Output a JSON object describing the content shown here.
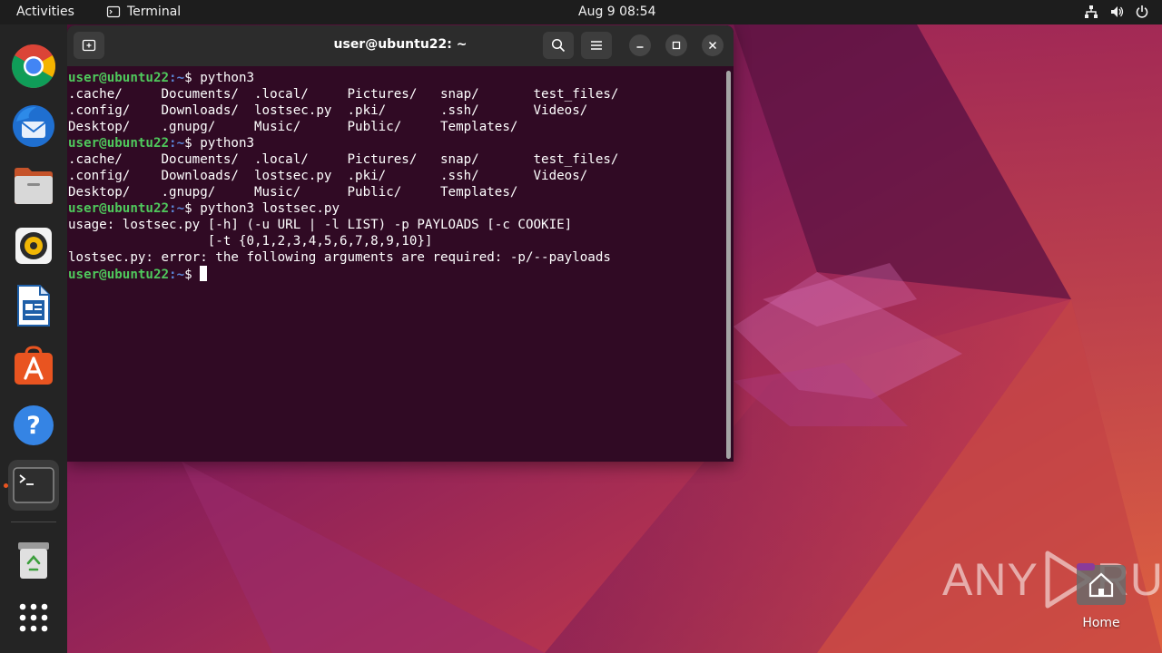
{
  "topbar": {
    "activities": "Activities",
    "app_name": "Terminal",
    "clock": "Aug 9  08:54",
    "tray_icons": [
      "network-icon",
      "volume-icon",
      "power-icon"
    ]
  },
  "dock": {
    "items": [
      {
        "name": "chrome-icon",
        "label": "Google Chrome"
      },
      {
        "name": "thunderbird-icon",
        "label": "Thunderbird"
      },
      {
        "name": "files-icon",
        "label": "Files"
      },
      {
        "name": "rhythmbox-icon",
        "label": "Rhythmbox"
      },
      {
        "name": "writer-icon",
        "label": "LibreOffice Writer"
      },
      {
        "name": "app-center-icon",
        "label": "Ubuntu Software"
      },
      {
        "name": "help-icon",
        "label": "Help"
      },
      {
        "name": "terminal-icon",
        "label": "Terminal"
      },
      {
        "name": "trash-icon",
        "label": "Trash"
      },
      {
        "name": "show-apps-icon",
        "label": "Show Applications"
      }
    ]
  },
  "terminal": {
    "title": "user@ubuntu22: ~",
    "prompt_user": "user@ubuntu22",
    "prompt_path": ":~",
    "prompt_symbol": "$ ",
    "lines": [
      {
        "type": "prompt",
        "cmd": "python3"
      },
      {
        "type": "out",
        "text": ".cache/     Documents/  .local/     Pictures/   snap/       test_files/"
      },
      {
        "type": "out",
        "text": ".config/    Downloads/  lostsec.py  .pki/       .ssh/       Videos/"
      },
      {
        "type": "out",
        "text": "Desktop/    .gnupg/     Music/      Public/     Templates/"
      },
      {
        "type": "prompt",
        "cmd": "python3"
      },
      {
        "type": "out",
        "text": ".cache/     Documents/  .local/     Pictures/   snap/       test_files/"
      },
      {
        "type": "out",
        "text": ".config/    Downloads/  lostsec.py  .pki/       .ssh/       Videos/"
      },
      {
        "type": "out",
        "text": "Desktop/    .gnupg/     Music/      Public/     Templates/"
      },
      {
        "type": "prompt",
        "cmd": "python3 lostsec.py"
      },
      {
        "type": "out",
        "text": "usage: lostsec.py [-h] (-u URL | -l LIST) -p PAYLOADS [-c COOKIE]"
      },
      {
        "type": "out",
        "text": "                  [-t {0,1,2,3,4,5,6,7,8,9,10}]"
      },
      {
        "type": "out",
        "text": "lostsec.py: error: the following arguments are required: -p/--payloads"
      },
      {
        "type": "prompt",
        "cmd": "",
        "cursor": true
      }
    ]
  },
  "desktop": {
    "home_label": "Home",
    "watermark_left": "ANY",
    "watermark_right": "RUN"
  },
  "colors": {
    "terminal_bg": "#300a24",
    "prompt_user": "#4fc95c",
    "prompt_path": "#5b86d8",
    "accent": "#e95420"
  }
}
